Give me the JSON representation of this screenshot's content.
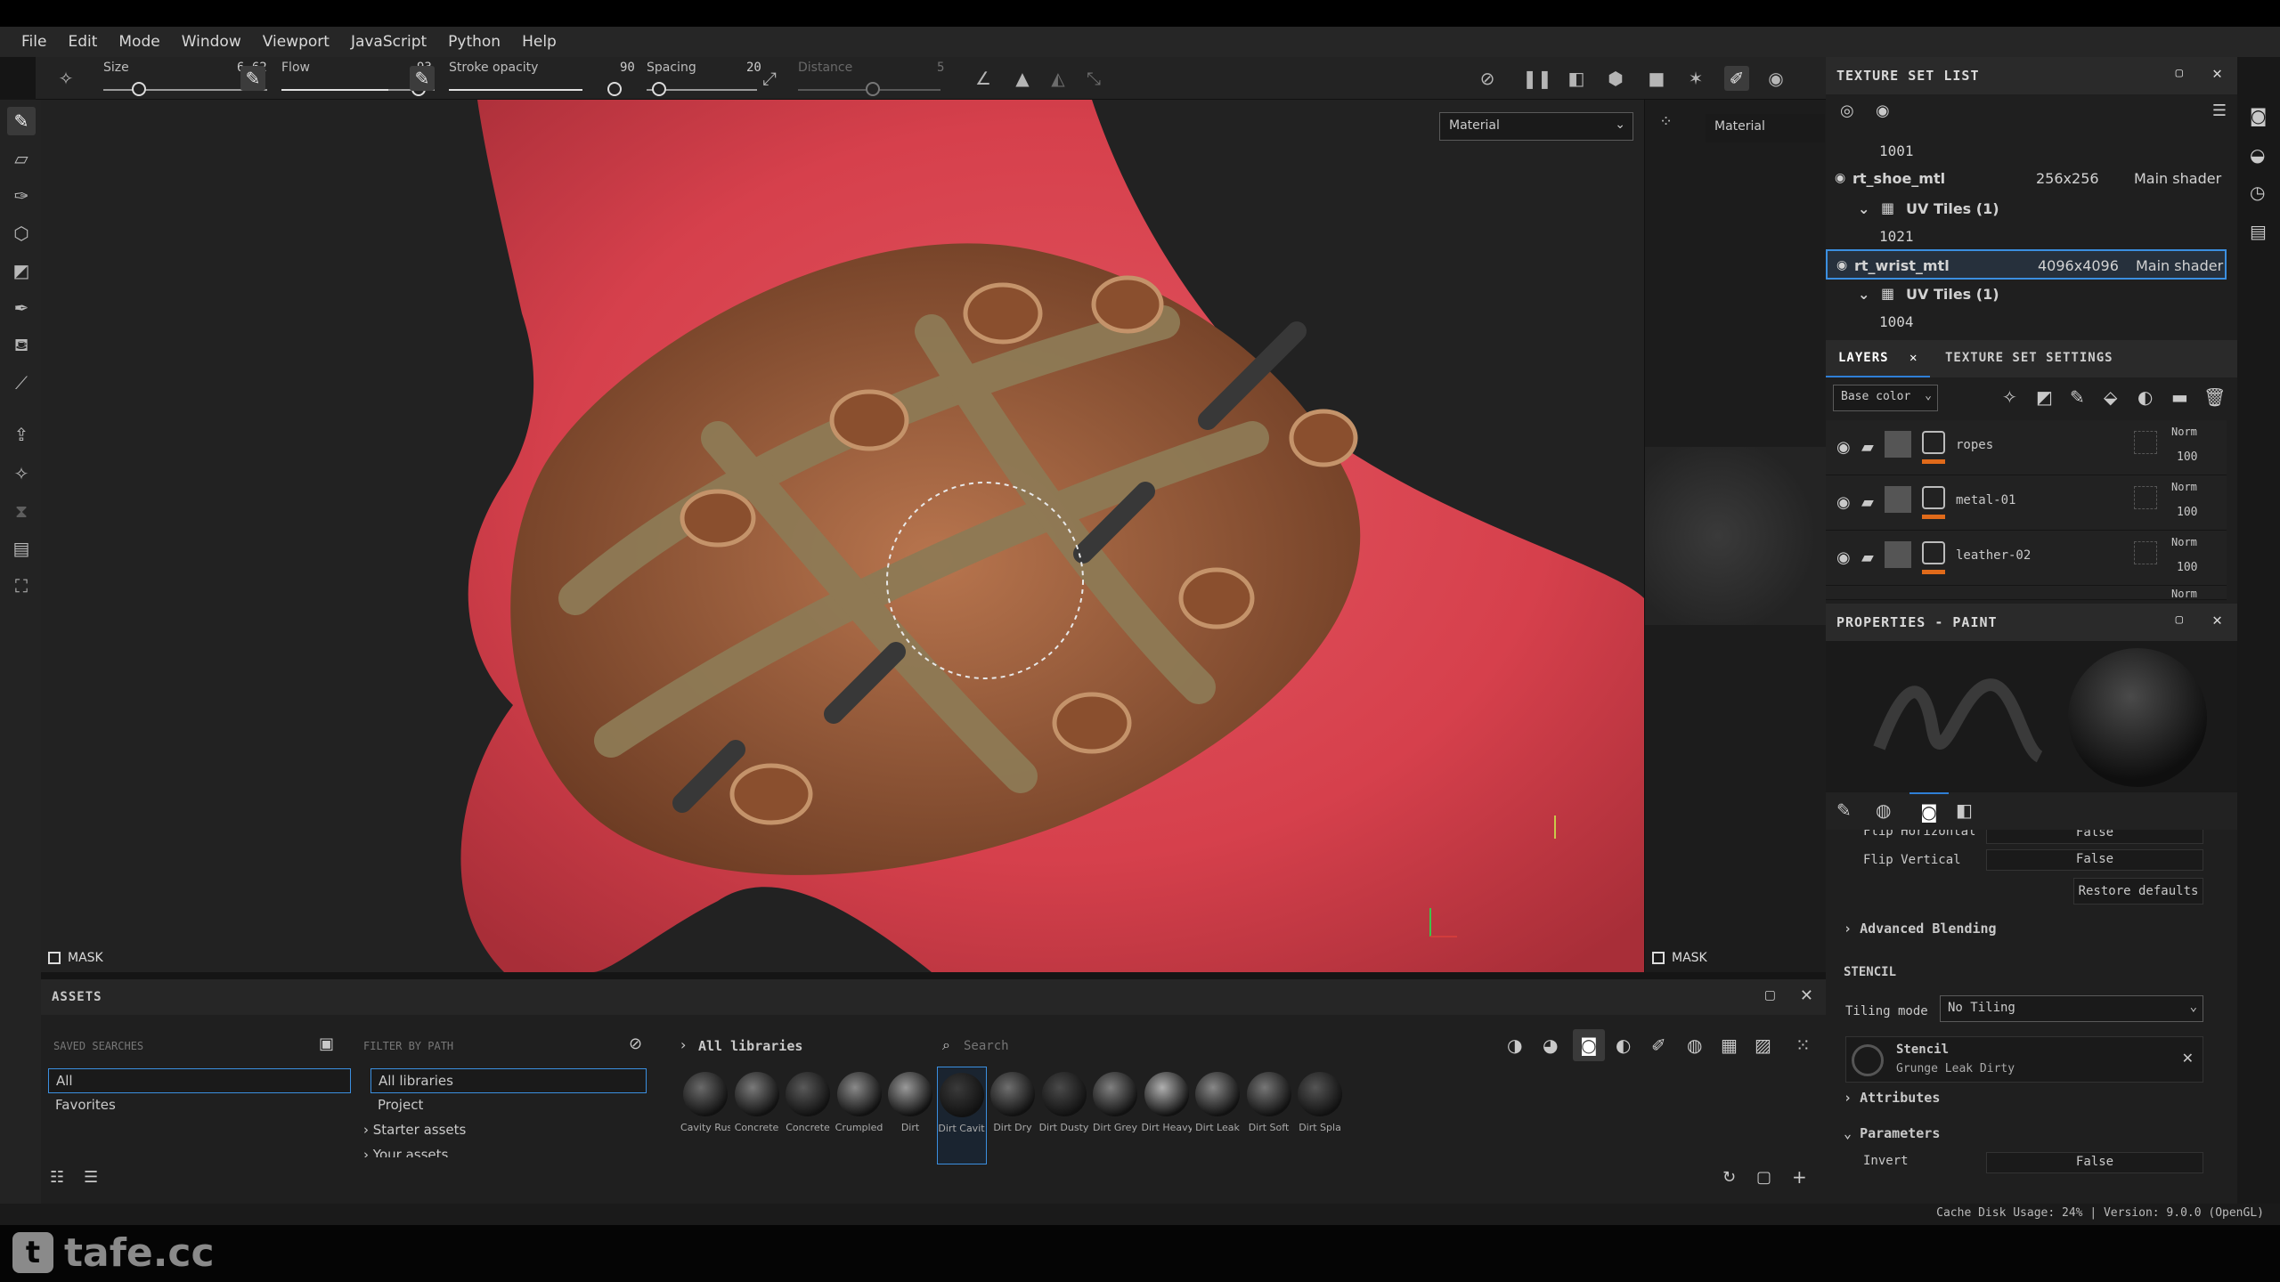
{
  "menu": [
    "File",
    "Edit",
    "Mode",
    "Window",
    "Viewport",
    "JavaScript",
    "Python",
    "Help"
  ],
  "toolbar": {
    "size_label": "Size",
    "size_value": "6.62",
    "flow_label": "Flow",
    "flow_value": "93",
    "stroke_label": "Stroke opacity",
    "stroke_value": "90",
    "spacing_label": "Spacing",
    "spacing_value": "20",
    "distance_label": "Distance",
    "distance_value": "5"
  },
  "viewport": {
    "material_select": "Material",
    "mask_label": "MASK"
  },
  "uv_view": {
    "material_label": "Material",
    "mask_label": "MASK"
  },
  "texture_set_list": {
    "title": "TEXTURE SET LIST",
    "rows": [
      {
        "kind": "tile",
        "text": "1001"
      },
      {
        "kind": "set",
        "name": "rt_shoe_mtl",
        "size": "256x256",
        "shader": "Main shader"
      },
      {
        "kind": "uv",
        "text": "UV Tiles (1)"
      },
      {
        "kind": "tile",
        "text": "1021"
      },
      {
        "kind": "set",
        "name": "rt_wrist_mtl",
        "size": "4096x4096",
        "shader": "Main shader",
        "selected": true
      },
      {
        "kind": "uv",
        "text": "UV Tiles (1)"
      },
      {
        "kind": "tile",
        "text": "1004"
      }
    ]
  },
  "layers": {
    "tab_layers": "LAYERS",
    "tab_settings": "TEXTURE SET SETTINGS",
    "channel": "Base color",
    "items": [
      {
        "name": "ropes",
        "blend": "Norm",
        "opacity": "100"
      },
      {
        "name": "metal-01",
        "blend": "Norm",
        "opacity": "100"
      },
      {
        "name": "leather-02",
        "blend": "Norm",
        "opacity": "100"
      }
    ],
    "partial_blend": "Norm"
  },
  "properties": {
    "title": "PROPERTIES - PAINT",
    "flip_h_label": "Flip Horizontal",
    "flip_h_value": "False",
    "flip_v_label": "Flip Vertical",
    "flip_v_value": "False",
    "restore": "Restore defaults",
    "advanced": "Advanced Blending",
    "stencil_header": "STENCIL",
    "tiling_label": "Tiling mode",
    "tiling_value": "No Tiling",
    "stencil_name": "Stencil",
    "stencil_resource": "Grunge Leak Dirty",
    "attributes": "Attributes",
    "parameters": "Parameters",
    "invert_label": "Invert",
    "invert_value": "False"
  },
  "assets": {
    "title": "ASSETS",
    "saved_searches": "SAVED SEARCHES",
    "filter_by_path": "FILTER BY PATH",
    "search_items": [
      "All",
      "Favorites"
    ],
    "path_items": [
      "All libraries",
      "Project",
      "Starter assets",
      "Your assets"
    ],
    "breadcrumb": "All libraries",
    "search_placeholder": "Search",
    "materials": [
      "Cavity Rust",
      "Concrete",
      "Concrete",
      "Crumpled",
      "Dirt",
      "Dirt Cavit",
      "Dirt Dry",
      "Dirt Dusty",
      "Dirt Grey",
      "Dirt Heavy",
      "Dirt Leak",
      "Dirt Soft",
      "Dirt Spla"
    ]
  },
  "status": {
    "text": "Cache Disk Usage:  24% | Version: 9.0.0 (OpenGL)"
  },
  "watermark": "tafe.cc",
  "colors": {
    "accent": "#2f7fd6",
    "orange": "#e06a1a",
    "selected_border": "#3b8fe0"
  }
}
